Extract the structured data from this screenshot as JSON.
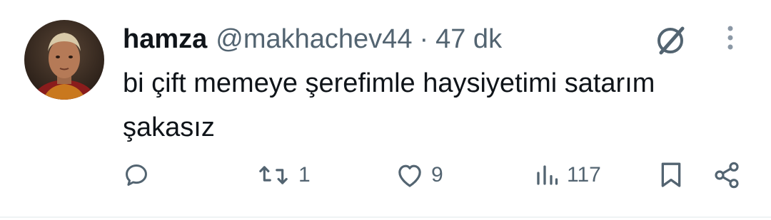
{
  "tweet": {
    "author_name": "hamza",
    "handle": "@makhachev44",
    "separator": "·",
    "time": "47 dk",
    "text": "bi çift memeye şerefimle haysiyetimi satarım\nşakasız"
  },
  "actions": {
    "reply_count": "",
    "retweet_count": "1",
    "like_count": "9",
    "view_count": "117"
  },
  "icons": {
    "reply": "reply-icon",
    "retweet": "retweet-icon",
    "like": "heart-icon",
    "views": "views-icon",
    "bookmark": "bookmark-icon",
    "share": "share-icon",
    "grok": "grok-icon",
    "more": "more-options-icon"
  },
  "colors": {
    "text_primary": "#0f1419",
    "text_secondary": "#536471",
    "divider": "#eff3f4"
  }
}
